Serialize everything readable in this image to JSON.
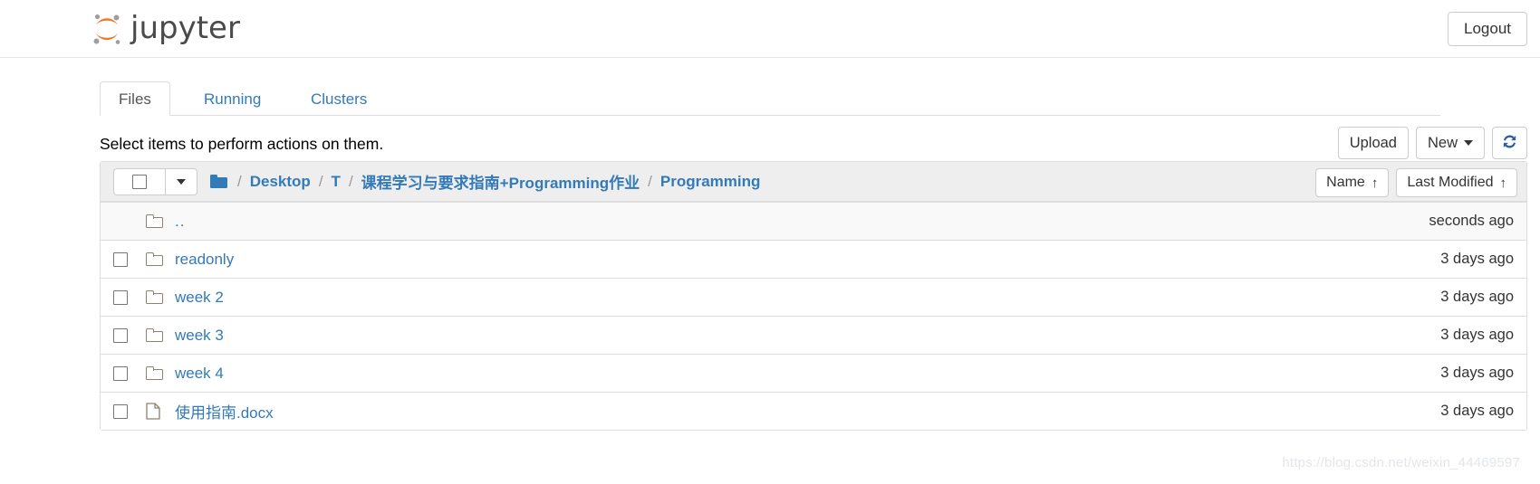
{
  "header": {
    "brand_text": "jupyter",
    "brand_icon": "jupyter-logo-icon",
    "logout_label": "Logout"
  },
  "colors": {
    "link_blue": "#337ab7",
    "logo_orange": "#f37726",
    "logo_gray": "#9e9e9e",
    "header_border": "#e7e7e7",
    "row_border": "#dddddd",
    "list_header_bg": "#eeeeee",
    "parent_row_bg": "#f9f9f9"
  },
  "tabs": [
    {
      "label": "Files",
      "active": true
    },
    {
      "label": "Running",
      "active": false
    },
    {
      "label": "Clusters",
      "active": false
    }
  ],
  "notification": {
    "message": "Select items to perform actions on them."
  },
  "toolbar": {
    "upload_label": "Upload",
    "new_label": "New",
    "new_caret_icon": "chevron-down-icon",
    "refresh_icon": "refresh-icon"
  },
  "list_header": {
    "select_all_checkbox_icon": "checkbox-unchecked-icon",
    "select_all_caret_icon": "chevron-down-icon",
    "breadcrumb_home_icon": "folder-icon",
    "breadcrumb_separator": "/",
    "breadcrumb": [
      "Desktop",
      "T",
      "课程学习与要求指南+Programming作业",
      "Programming"
    ],
    "sort_name_label": "Name",
    "sort_name_arrow": "↑",
    "sort_modified_label": "Last Modified",
    "sort_modified_arrow": "↑"
  },
  "files": [
    {
      "name": "..",
      "icon": "folder-icon",
      "type": "parent-directory",
      "has_checkbox": false,
      "modified": "seconds ago"
    },
    {
      "name": "readonly",
      "icon": "folder-icon",
      "type": "directory",
      "has_checkbox": true,
      "modified": "3 days ago"
    },
    {
      "name": "week 2",
      "icon": "folder-icon",
      "type": "directory",
      "has_checkbox": true,
      "modified": "3 days ago"
    },
    {
      "name": "week 3",
      "icon": "folder-icon",
      "type": "directory",
      "has_checkbox": true,
      "modified": "3 days ago"
    },
    {
      "name": "week 4",
      "icon": "folder-icon",
      "type": "directory",
      "has_checkbox": true,
      "modified": "3 days ago"
    },
    {
      "name": "使用指南.docx",
      "icon": "file-icon",
      "type": "file",
      "has_checkbox": true,
      "modified": "3 days ago"
    }
  ],
  "watermark": {
    "text": "https://blog.csdn.net/weixin_44469597"
  }
}
